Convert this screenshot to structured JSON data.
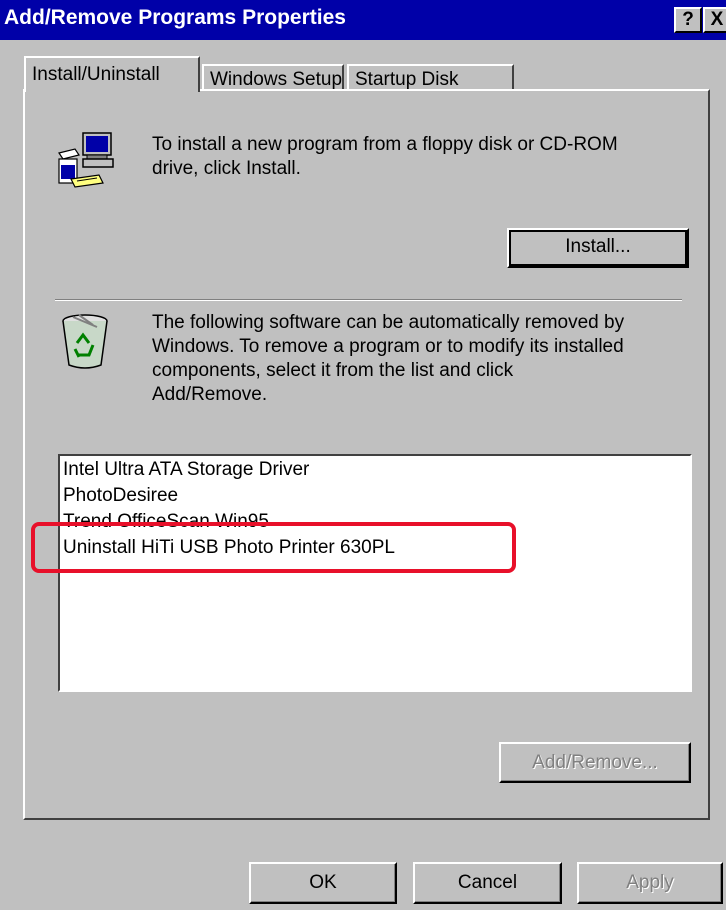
{
  "window": {
    "title": "Add/Remove Programs Properties",
    "help_label": "?",
    "close_label": "X"
  },
  "tabs": [
    {
      "label": "Install/Uninstall",
      "active": true
    },
    {
      "label": "Windows Setup",
      "active": false
    },
    {
      "label": "Startup Disk",
      "active": false
    }
  ],
  "install_section": {
    "icon": "computer-install-icon",
    "text_line1": "To install a new program from a floppy disk or CD-ROM",
    "text_line2": "drive, click Install.",
    "install_button": "Install..."
  },
  "uninstall_section": {
    "icon": "recycle-bin-icon",
    "text_line1": "The following software can be automatically removed by",
    "text_line2": "Windows. To remove a program or to modify its installed",
    "text_line3": "components, select it from the list and click",
    "text_line4": "Add/Remove.",
    "programs": [
      "Intel Ultra ATA Storage Driver",
      "PhotoDesiree",
      "Trend OfficeScan Win95",
      "Uninstall HiTi USB Photo Printer 630PL"
    ],
    "add_remove_button": "Add/Remove..."
  },
  "footer": {
    "ok": "OK",
    "cancel": "Cancel",
    "apply": "Apply"
  },
  "colors": {
    "titlebar": "#0000a8",
    "face": "#c0c0c0",
    "highlight_annotation": "#e8102a"
  }
}
